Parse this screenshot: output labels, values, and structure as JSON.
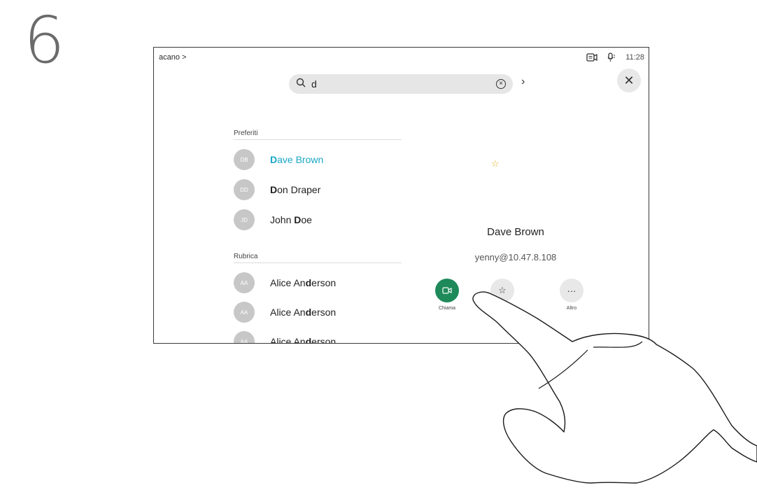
{
  "step": "6",
  "header": {
    "breadcrumb": "acano >",
    "time": "11:28"
  },
  "search": {
    "value": "d"
  },
  "sections": {
    "favorites": "Preferiti",
    "directory": "Rubrica"
  },
  "favorites": [
    {
      "initials": "DB",
      "name_bold": "D",
      "name_rest": "ave Brown",
      "selected": true
    },
    {
      "initials": "DD",
      "name_bold": "D",
      "name_rest": "on Draper",
      "selected": false
    },
    {
      "initials": "JD",
      "name_pre": "John ",
      "name_bold": "D",
      "name_rest": "oe",
      "selected": false
    }
  ],
  "directory": [
    {
      "initials": "AA",
      "name_pre": "Alice An",
      "name_bold": "d",
      "name_rest": "erson"
    },
    {
      "initials": "AA",
      "name_pre": "Alice An",
      "name_bold": "d",
      "name_rest": "erson"
    },
    {
      "initials": "AA",
      "name_pre": "Alice An",
      "name_bold": "d",
      "name_rest": "erson"
    }
  ],
  "detail": {
    "name": "Dave Brown",
    "address": "yenny@10.47.8.108",
    "actions": {
      "call": "Chiama",
      "more": "Altro"
    }
  },
  "colors": {
    "accent": "#1aa7c6",
    "call_green": "#1e8a5a",
    "favorite_star": "#e7b416"
  },
  "icons": [
    "search-icon",
    "clear-icon",
    "chevron-right-icon",
    "close-icon",
    "camera-icon",
    "mic-icon",
    "star-icon",
    "more-icon",
    "video-call-icon"
  ]
}
